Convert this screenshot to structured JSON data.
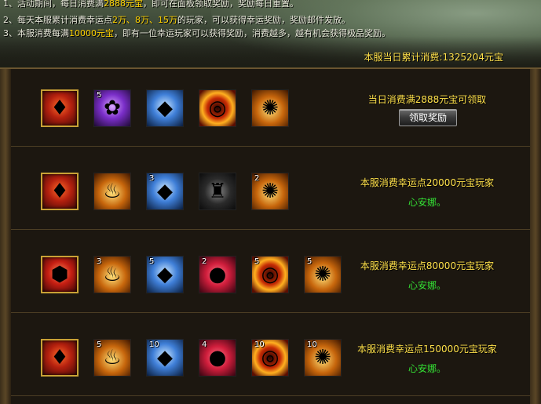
{
  "header": {
    "rules": [
      {
        "prefix": "1、活动期间，每日消费满",
        "highlight": "2888元宝",
        "suffix": "，即可在面板领取奖励，奖励每日重置。"
      },
      {
        "prefix": "2、每天本服累计消费幸运点",
        "highlight": "2万、8万、15万",
        "suffix": "的玩家，可以获得幸运奖励，奖励邮件发放。"
      },
      {
        "prefix": "3、本服消费每满",
        "highlight": "10000元宝",
        "suffix": "，即有一位幸运玩家可以获得奖励，消费越多，越有机会获得极品奖励。"
      }
    ],
    "total_label": "本服当日累计消费:",
    "total_value": "1325204元宝"
  },
  "colors": {
    "accent_yellow": "#ffe14a",
    "winner_green": "#34e034",
    "frame_gold": "#c9a135",
    "highlight": "#ffd200"
  },
  "rows": [
    {
      "description": "当日消费满2888元宝可领取",
      "button_label": "领取奖励",
      "items": [
        {
          "icon": "red-crystal-cluster-icon",
          "count": ""
        },
        {
          "icon": "purple-lotus-icon",
          "count": "5"
        },
        {
          "icon": "blue-crystal-icon",
          "count": ""
        },
        {
          "icon": "fire-ring-icon",
          "count": ""
        },
        {
          "icon": "fire-orb-icon",
          "count": ""
        }
      ]
    },
    {
      "description": "本服消费幸运点20000元宝玩家",
      "winner": "心安娜。",
      "items": [
        {
          "icon": "red-crystal-shard-icon",
          "count": ""
        },
        {
          "icon": "golden-cauldron-icon",
          "count": ""
        },
        {
          "icon": "blue-crystal-icon",
          "count": "3"
        },
        {
          "icon": "dark-armor-icon",
          "count": ""
        },
        {
          "icon": "fire-orb-icon",
          "count": "2"
        }
      ]
    },
    {
      "description": "本服消费幸运点80000元宝玩家",
      "winner": "心安娜。",
      "items": [
        {
          "icon": "red-gem-icon",
          "count": ""
        },
        {
          "icon": "golden-cauldron-icon",
          "count": "3"
        },
        {
          "icon": "blue-crystal-icon",
          "count": "5"
        },
        {
          "icon": "red-dragon-egg-icon",
          "count": "2"
        },
        {
          "icon": "fire-ring-icon",
          "count": "5"
        },
        {
          "icon": "fire-orb-icon",
          "count": "5"
        }
      ]
    },
    {
      "description": "本服消费幸运点150000元宝玩家",
      "winner": "心安娜。",
      "items": [
        {
          "icon": "red-rune-gem-icon",
          "count": ""
        },
        {
          "icon": "golden-cauldron-icon",
          "count": "5"
        },
        {
          "icon": "blue-crystal-icon",
          "count": "10"
        },
        {
          "icon": "red-dragon-egg-icon",
          "count": "4"
        },
        {
          "icon": "fire-ring-icon",
          "count": "10"
        },
        {
          "icon": "fire-orb-icon",
          "count": "10"
        }
      ]
    }
  ]
}
